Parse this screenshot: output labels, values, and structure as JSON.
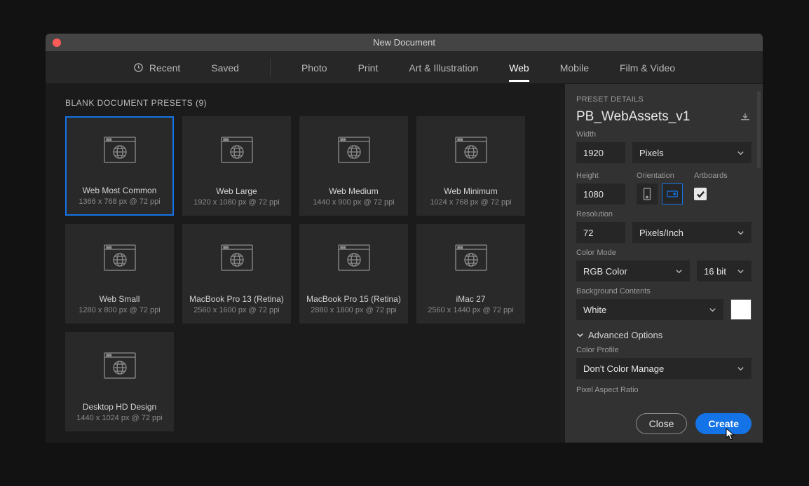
{
  "window": {
    "title": "New Document"
  },
  "tabs": {
    "recent": "Recent",
    "saved": "Saved",
    "photo": "Photo",
    "print": "Print",
    "art": "Art & Illustration",
    "web": "Web",
    "mobile": "Mobile",
    "film": "Film & Video"
  },
  "presets_header": "BLANK DOCUMENT PRESETS   (9)",
  "presets": [
    {
      "title": "Web Most Common",
      "sub": "1366 x 768 px @ 72 ppi"
    },
    {
      "title": "Web Large",
      "sub": "1920 x 1080 px @ 72 ppi"
    },
    {
      "title": "Web Medium",
      "sub": "1440 x 900 px @ 72 ppi"
    },
    {
      "title": "Web Minimum",
      "sub": "1024 x 768 px @ 72 ppi"
    },
    {
      "title": "Web Small",
      "sub": "1280 x 800 px @ 72 ppi"
    },
    {
      "title": "MacBook Pro 13 (Retina)",
      "sub": "2560 x 1600 px @ 72 ppi"
    },
    {
      "title": "MacBook Pro 15 (Retina)",
      "sub": "2880 x 1800 px @ 72 ppi"
    },
    {
      "title": "iMac 27",
      "sub": "2560 x 1440 px @ 72 ppi"
    },
    {
      "title": "Desktop HD Design",
      "sub": "1440 x 1024 px @ 72 ppi"
    }
  ],
  "details": {
    "header": "PRESET DETAILS",
    "name": "PB_WebAssets_v1",
    "width_label": "Width",
    "width_value": "1920",
    "width_unit": "Pixels",
    "height_label": "Height",
    "height_value": "1080",
    "orientation_label": "Orientation",
    "artboards_label": "Artboards",
    "resolution_label": "Resolution",
    "resolution_value": "72",
    "resolution_unit": "Pixels/Inch",
    "colormode_label": "Color Mode",
    "colormode_value": "RGB Color",
    "colormode_bits": "16 bit",
    "bg_label": "Background Contents",
    "bg_value": "White",
    "advanced_label": "Advanced Options",
    "colorprofile_label": "Color Profile",
    "colorprofile_value": "Don't Color Manage",
    "pixelaspect_label": "Pixel Aspect Ratio"
  },
  "buttons": {
    "close": "Close",
    "create": "Create"
  }
}
